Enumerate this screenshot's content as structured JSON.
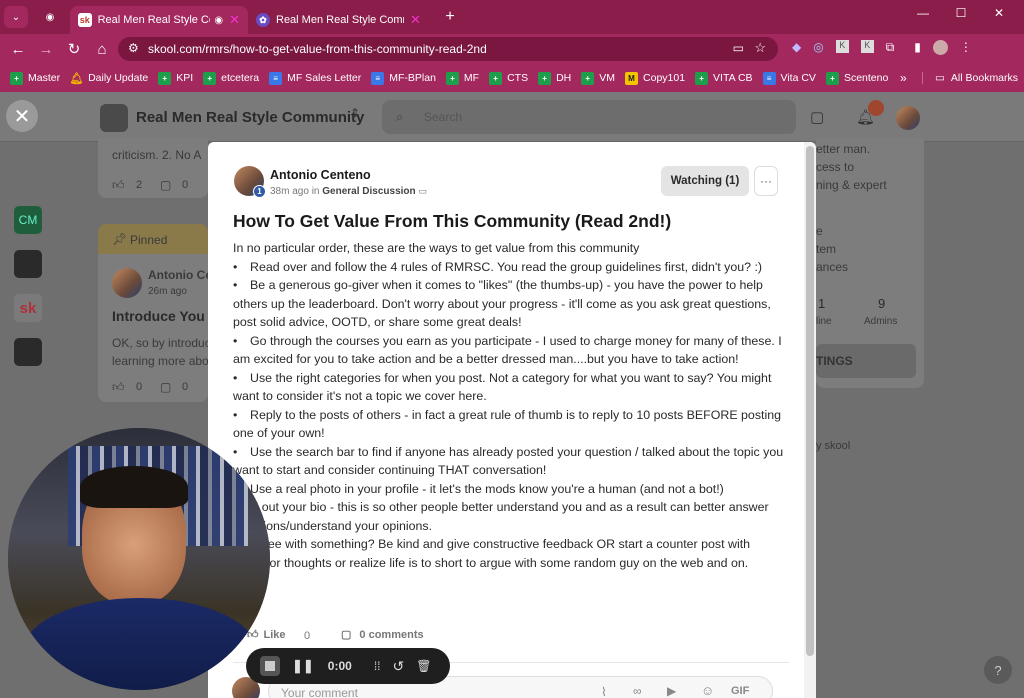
{
  "browser": {
    "tabs": [
      {
        "label": "Real Men Real Style Commu",
        "active": true
      },
      {
        "label": "Real Men Real Style Community",
        "active": false
      }
    ],
    "url": "skool.com/rmrs/how-to-get-value-from-this-community-read-2nd",
    "bookmarks": [
      "Master",
      "Daily Update",
      "KPI",
      "etcetera",
      "MF Sales Letter",
      "MF-BPlan",
      "MF",
      "CTS",
      "DH",
      "VM",
      "Copy101",
      "VITA CB",
      "Vita CV",
      "Scenteno"
    ],
    "all_bookmarks": "All Bookmarks",
    "more": "»"
  },
  "skool": {
    "community_name": "Real Men Real Style Community",
    "search_placeholder": "Search",
    "notif_count": "",
    "left_icons": [
      "CM",
      "",
      "sk",
      ""
    ],
    "bg_post1": {
      "snippet": "criticism. 2. No A",
      "likes": "2",
      "comments": "0"
    },
    "bg_pinned_label": "Pinned",
    "bg_post2": {
      "author": "Antonio Ce",
      "time": "26m ago",
      "title": "Introduce You",
      "snippet1": "OK, so by introduc",
      "snippet2": "learning more abo",
      "likes": "0",
      "comments": "0"
    },
    "bg_post3": {
      "likes": "0",
      "comments": "0"
    },
    "sidebar": {
      "lines": [
        "etter man.",
        "cess to",
        "ning & expert",
        "e",
        "tem",
        "ances"
      ],
      "stat1": "1",
      "stat1_label": "line",
      "stat2": "9",
      "stat2_label": "Admins",
      "settings": "TINGS",
      "powered": "y skool"
    }
  },
  "post": {
    "author": "Antonio Centeno",
    "level": "1",
    "time": "38m ago",
    "in": "in",
    "category": "General Discussion",
    "watch_label": "Watching (1)",
    "more_label": "···",
    "title": "How To Get Value From This Community (Read 2nd!)",
    "intro": "In no particular order, these are the ways to get value from this community",
    "bullets": [
      "Read over and follow the 4 rules of RMRSC. You read the group guidelines first, didn't you? :)",
      "Be a generous go-giver when it comes to \"likes\" (the thumbs-up) - you have the power to help others up the leaderboard. Don't worry about your progress - it'll come as you ask great questions, post solid advice, OOTD, or share some great deals!",
      "Go through the courses you earn as you participate - I used to charge money for many of these. I am excited for you to take action and be a better dressed man....but you have to take action!",
      "Use the right categories for when you post. Not a category for what you want to say? You might want to consider it's not a topic we cover here.",
      "Reply to the posts of others - in fact a great rule of thumb is to reply to 10 posts BEFORE posting one of your own!",
      "Use the search bar to find if anyone has already posted your question / talked about the topic you want to start and consider continuing THAT conversation!",
      "Use a real photo in your profile - it let's the mods know you're a human (and not a bot!)",
      "ill out your bio - this is so other people better understand you and as a result can better answer questions/understand your opinions.",
      "agree with something? Be kind and give constructive feedback OR start a counter post with pinion or thoughts or realize life is to short to argue with some random guy on the web and on."
    ],
    "like_label": "Like",
    "like_count": "0",
    "comments_label": "0 comments",
    "comment_placeholder": "Your comment",
    "gif_label": "GIF"
  },
  "recorder": {
    "time": "0:00"
  },
  "help_label": "?"
}
